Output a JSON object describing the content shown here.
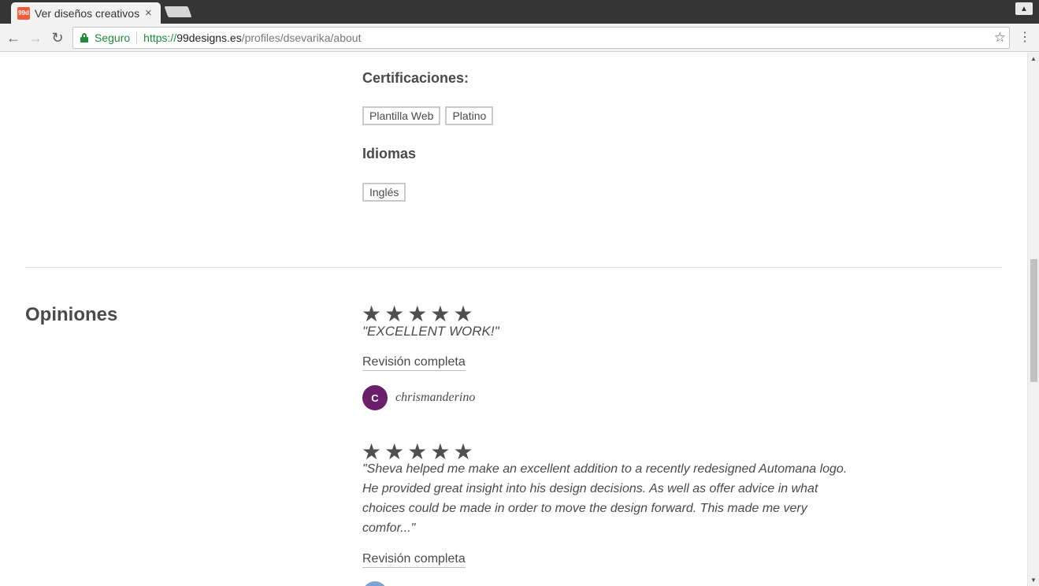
{
  "browser": {
    "tab_title": "Ver diseños creativos",
    "favicon_text": "99d",
    "secure_label": "Seguro",
    "url_scheme": "https://",
    "url_host": "99designs.es",
    "url_path": "/profiles/dsevarika/about",
    "accent_color": "#1e8c3a"
  },
  "certifications": {
    "heading": "Certificaciones:",
    "items": [
      "Plantilla Web",
      "Platino"
    ]
  },
  "languages": {
    "heading": "Idiomas",
    "items": [
      "Inglés"
    ]
  },
  "reviews": {
    "section_title": "Opiniones",
    "items": [
      {
        "rating": 5,
        "quote": "\"EXCELLENT WORK!\"",
        "full_review_label": "Revisión completa",
        "reviewer": {
          "initial": "C",
          "name": "chrismanderino",
          "avatar_color": "#6b1f6b"
        }
      },
      {
        "rating": 5,
        "quote": "\"Sheva helped me make an excellent addition to a recently redesigned Automana logo. He provided great insight into his design decisions. As well as offer advice in what choices could be made in order to move the design forward. This made me very comfor...\"",
        "full_review_label": "Revisión completa",
        "reviewer": {
          "avatar_color": "#7fa2d6"
        }
      }
    ]
  }
}
